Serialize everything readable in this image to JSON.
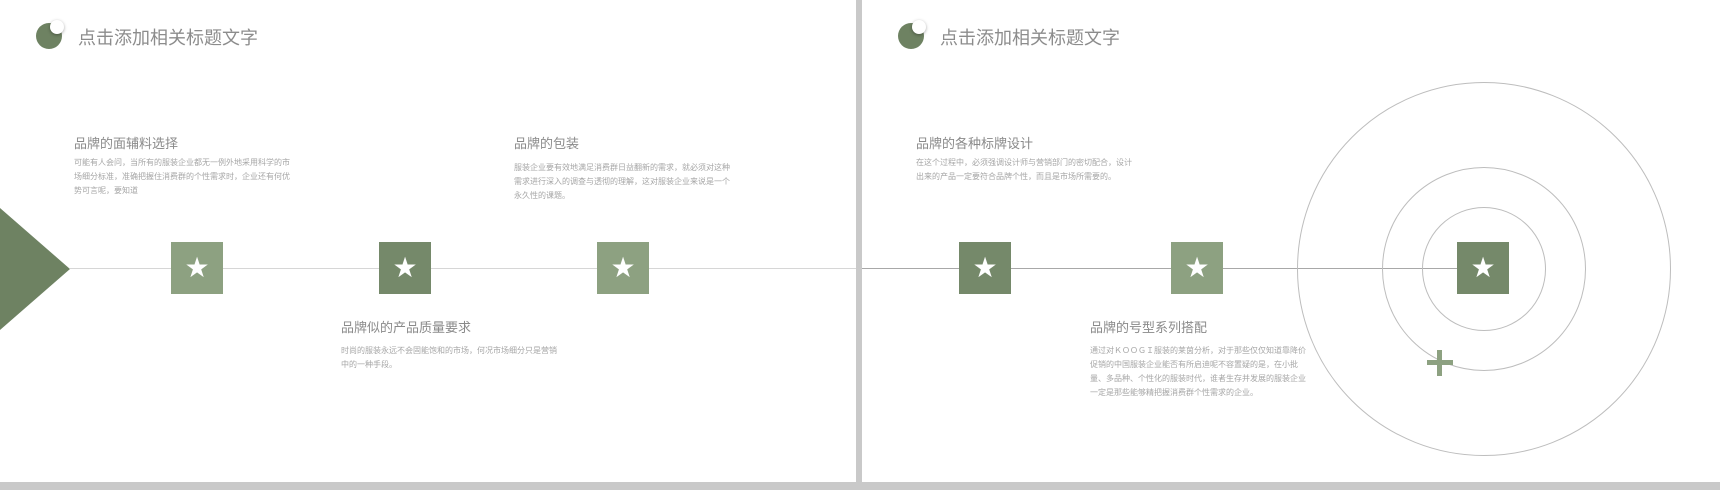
{
  "slides": [
    {
      "title": "点击添加相关标题文字",
      "blocks": [
        {
          "title": "品牌的面辅料选择",
          "body": "可能有人会问，当所有的服装企业都无一例外地采用科学的市场细分标准，准确把握住消费群的个性需求时，企业还有何优势可言呢，要知道"
        },
        {
          "title": "品牌的包装",
          "body": "服装企业要有效地满足消费群日益翻新的需求，就必须对这种需求进行深入的调查与透彻的理解，这对服装企业来说是一个永久性的课题。"
        },
        {
          "title": "品牌似的产品质量要求",
          "body": "时尚的服装永远不会固能饱和的市场，何况市场细分只是营销中的一种手段。"
        }
      ],
      "icons": [
        "star-icon",
        "star-icon",
        "star-icon"
      ]
    },
    {
      "title": "点击添加相关标题文字",
      "blocks": [
        {
          "title": "品牌的各种标牌设计",
          "body": "在这个过程中，必须强调设计师与营销部门的密切配合，设计出来的产品一定要符合品牌个性，而且是市场所需要的。"
        },
        {
          "title": "品牌的号型系列搭配",
          "body": "通过对ＫＯＯＧＩ服装的莱茵分析，对于那些仅仅知道靠降价促销的中国服装企业能否有所启迪呢不容置疑的是，在小批量、多品种、个性化的服装时代，谁者生存并发展的服装企业一定是那些能够精把握消费群个性需求的企业。"
        }
      ],
      "icons": [
        "star-icon",
        "star-icon",
        "star-icon",
        "plus-icon"
      ]
    }
  ],
  "colors": {
    "accent": "#6e8262",
    "accent_light": "#8da181",
    "accent_dark": "#75896a",
    "text": "#8a8a8a",
    "line": "#d6d6d6"
  },
  "glyphs": {
    "star": "★"
  }
}
